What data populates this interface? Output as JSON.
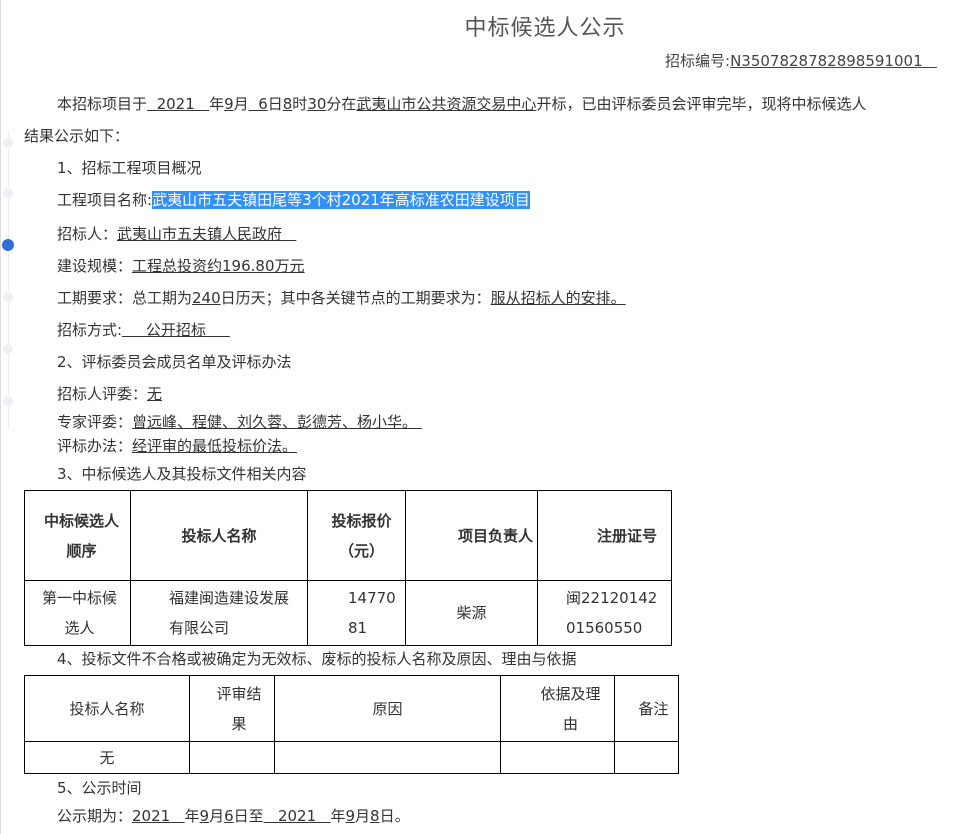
{
  "document": {
    "title": "中标候选人公示",
    "tender_no_label": "招标编号:",
    "tender_no_value": "N3507828782898591001",
    "intro": {
      "p1": "本招标项目于",
      "year": "2021",
      "p2": "年",
      "month": "9",
      "p3": "月",
      "day": "6",
      "p4": "日",
      "hour": "8",
      "p5": "时",
      "minute": "30",
      "p6": "分在",
      "venue": "武夷山市公共资源交易中心",
      "p7": "开标，已由评标委员会评审完毕，现将中标候选人",
      "line2": "结果公示如下："
    },
    "section1": {
      "heading": "1、招标工程项目概况",
      "project_label": "工程项目名称:",
      "project_value": "武夷山市五夫镇田尾等3个村2021年高标准农田建设项目",
      "tenderer_label": "招标人：",
      "tenderer_value": "武夷山市五夫镇人民政府",
      "scale_label": "建设规模：",
      "scale_value": "工程总投资约196.80万元",
      "period_p1": "工期要求：总工期为",
      "period_days": "240",
      "period_p2": "日历天；其中各关键节点的工期要求为：",
      "period_value": "服从招标人的安排。",
      "method_label": "招标方式:",
      "method_value": "公开招标"
    },
    "section2": {
      "heading": "2、评标委员会成员名单及评标办法",
      "owner_label": "招标人评委：",
      "owner_value": "无",
      "expert_label": "专家评委：",
      "expert_value": "曾远峰、程健、刘久蓉、彭德芳、杨小华。",
      "eval_label": "评标办法：",
      "eval_value": "经评审的最低投标价法。"
    },
    "section3": {
      "heading": "3、中标候选人及其投标文件相关内容",
      "table": {
        "headers": [
          "中标候选人顺序",
          "投标人名称",
          "投标报价（元）",
          "项目负责人",
          "注册证号"
        ],
        "rows": [
          [
            "第一中标候选人",
            "福建闽造建设发展有限公司",
            "1477081",
            "柴源",
            "闽2212014201560550"
          ]
        ]
      }
    },
    "section4": {
      "heading": "4、投标文件不合格或被确定为无效标、废标的投标人名称及原因、理由与依据",
      "table": {
        "headers": [
          "投标人名称",
          "评审结果",
          "原因",
          "依据及理由",
          "备注"
        ],
        "rows": [
          [
            "无",
            "",
            "",
            "",
            ""
          ]
        ]
      }
    },
    "section5": {
      "heading": "5、公示时间",
      "label": "公示期为：",
      "start_year": "2021",
      "start_month": "9",
      "start_day": "6",
      "to": "日至",
      "end_year": "2021",
      "end_month": "9",
      "end_day": "8",
      "end": "日。",
      "y": "年",
      "m": "月"
    }
  },
  "colors": {
    "highlight": "#3390ff",
    "active_dot": "#2f6fd6"
  }
}
